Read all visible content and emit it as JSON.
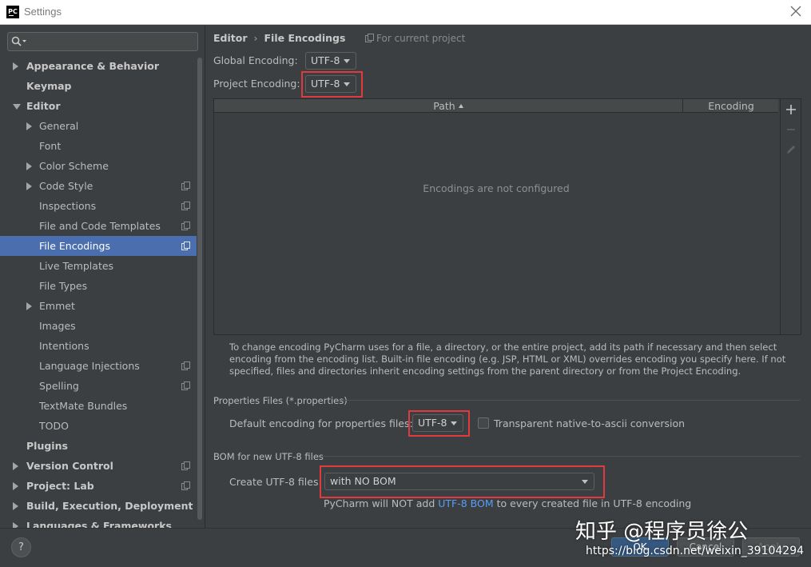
{
  "window": {
    "title": "Settings",
    "app_icon_text": "PC"
  },
  "sidebar": {
    "search_placeholder": "",
    "items": [
      {
        "label": "Appearance & Behavior",
        "level": 0,
        "expander": "collapsed",
        "bold": true,
        "copy_icon": false
      },
      {
        "label": "Keymap",
        "level": 0,
        "expander": "none",
        "bold": true,
        "copy_icon": false
      },
      {
        "label": "Editor",
        "level": 0,
        "expander": "expanded",
        "bold": true,
        "copy_icon": false
      },
      {
        "label": "General",
        "level": 1,
        "expander": "collapsed",
        "bold": false,
        "copy_icon": false
      },
      {
        "label": "Font",
        "level": 1,
        "expander": "none",
        "bold": false,
        "copy_icon": false
      },
      {
        "label": "Color Scheme",
        "level": 1,
        "expander": "collapsed",
        "bold": false,
        "copy_icon": false
      },
      {
        "label": "Code Style",
        "level": 1,
        "expander": "collapsed",
        "bold": false,
        "copy_icon": true
      },
      {
        "label": "Inspections",
        "level": 1,
        "expander": "none",
        "bold": false,
        "copy_icon": true
      },
      {
        "label": "File and Code Templates",
        "level": 1,
        "expander": "none",
        "bold": false,
        "copy_icon": true
      },
      {
        "label": "File Encodings",
        "level": 1,
        "expander": "none",
        "bold": false,
        "copy_icon": true,
        "selected": true
      },
      {
        "label": "Live Templates",
        "level": 1,
        "expander": "none",
        "bold": false,
        "copy_icon": false
      },
      {
        "label": "File Types",
        "level": 1,
        "expander": "none",
        "bold": false,
        "copy_icon": false
      },
      {
        "label": "Emmet",
        "level": 1,
        "expander": "collapsed",
        "bold": false,
        "copy_icon": false
      },
      {
        "label": "Images",
        "level": 1,
        "expander": "none",
        "bold": false,
        "copy_icon": false
      },
      {
        "label": "Intentions",
        "level": 1,
        "expander": "none",
        "bold": false,
        "copy_icon": false
      },
      {
        "label": "Language Injections",
        "level": 1,
        "expander": "none",
        "bold": false,
        "copy_icon": true
      },
      {
        "label": "Spelling",
        "level": 1,
        "expander": "none",
        "bold": false,
        "copy_icon": true
      },
      {
        "label": "TextMate Bundles",
        "level": 1,
        "expander": "none",
        "bold": false,
        "copy_icon": false
      },
      {
        "label": "TODO",
        "level": 1,
        "expander": "none",
        "bold": false,
        "copy_icon": false
      },
      {
        "label": "Plugins",
        "level": 0,
        "expander": "none",
        "bold": true,
        "copy_icon": false
      },
      {
        "label": "Version Control",
        "level": 0,
        "expander": "collapsed",
        "bold": true,
        "copy_icon": true
      },
      {
        "label": "Project: Lab",
        "level": 0,
        "expander": "collapsed",
        "bold": true,
        "copy_icon": true
      },
      {
        "label": "Build, Execution, Deployment",
        "level": 0,
        "expander": "collapsed",
        "bold": true,
        "copy_icon": false
      },
      {
        "label": "Languages & Frameworks",
        "level": 0,
        "expander": "collapsed",
        "bold": true,
        "copy_icon": false
      }
    ]
  },
  "main": {
    "breadcrumb": {
      "parent": "Editor",
      "separator": "›",
      "current": "File Encodings"
    },
    "scope_note": "For current project",
    "global_encoding": {
      "label": "Global Encoding:",
      "value": "UTF-8"
    },
    "project_encoding": {
      "label": "Project Encoding:",
      "value": "UTF-8"
    },
    "table": {
      "columns": [
        "Path",
        "Encoding"
      ],
      "sorted_column": "Path",
      "sort_direction": "ascending",
      "empty_message": "Encodings are not configured",
      "toolbar": [
        "add-icon",
        "remove-icon",
        "edit-icon"
      ]
    },
    "help_text": "To change encoding PyCharm uses for a file, a directory, or the entire project, add its path if necessary and then select encoding from the encoding list. Built-in file encoding (e.g. JSP, HTML or XML) overrides encoding you specify here. If not specified, files and directories inherit encoding settings from the parent directory or from the Project Encoding.",
    "properties": {
      "section_title": "Properties Files (*.properties)",
      "default_label": "Default encoding for properties files:",
      "default_value": "UTF-8",
      "native_to_ascii_label": "Transparent native-to-ascii conversion",
      "native_to_ascii_checked": false
    },
    "bom": {
      "section_title": "BOM for new UTF-8 files",
      "create_label": "Create UTF-8 files:",
      "create_value": "with NO BOM",
      "note_prefix": "PyCharm will NOT add",
      "note_link": "UTF-8 BOM",
      "note_suffix": "to every created file in UTF-8 encoding"
    }
  },
  "footer": {
    "help_label": "?",
    "ok_label": "OK",
    "cancel_label": "Cancel",
    "apply_label": "Apply"
  },
  "watermark": {
    "zhihu": "知乎 @程序员徐公",
    "url": "https://blog.csdn.net/weixin_39104294"
  },
  "colors": {
    "background": "#3c3f41",
    "selection": "#4b6eaf",
    "highlight_box": "#e0393e",
    "link": "#589df6"
  }
}
